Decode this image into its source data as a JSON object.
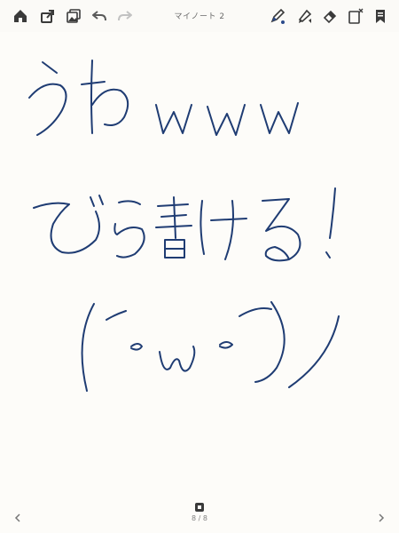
{
  "toolbar": {
    "title": "マイノート 2",
    "buttons": [
      {
        "name": "home-icon"
      },
      {
        "name": "share-icon"
      },
      {
        "name": "gallery-icon"
      },
      {
        "name": "undo-icon"
      },
      {
        "name": "redo-icon"
      },
      {
        "name": "pen-tool-icon"
      },
      {
        "name": "highlighter-tool-icon"
      },
      {
        "name": "eraser-tool-icon"
      },
      {
        "name": "new-page-icon"
      },
      {
        "name": "bookmark-icon"
      }
    ],
    "accent_color": "#2b4a8a"
  },
  "canvas": {
    "ink_color": "#1f3c73",
    "background_color": "#fdfcf9"
  },
  "footer": {
    "current_page": "8",
    "separator": "/",
    "total_pages": "8",
    "prev_icon": "chevron-left-icon",
    "next_icon": "chevron-right-icon"
  }
}
